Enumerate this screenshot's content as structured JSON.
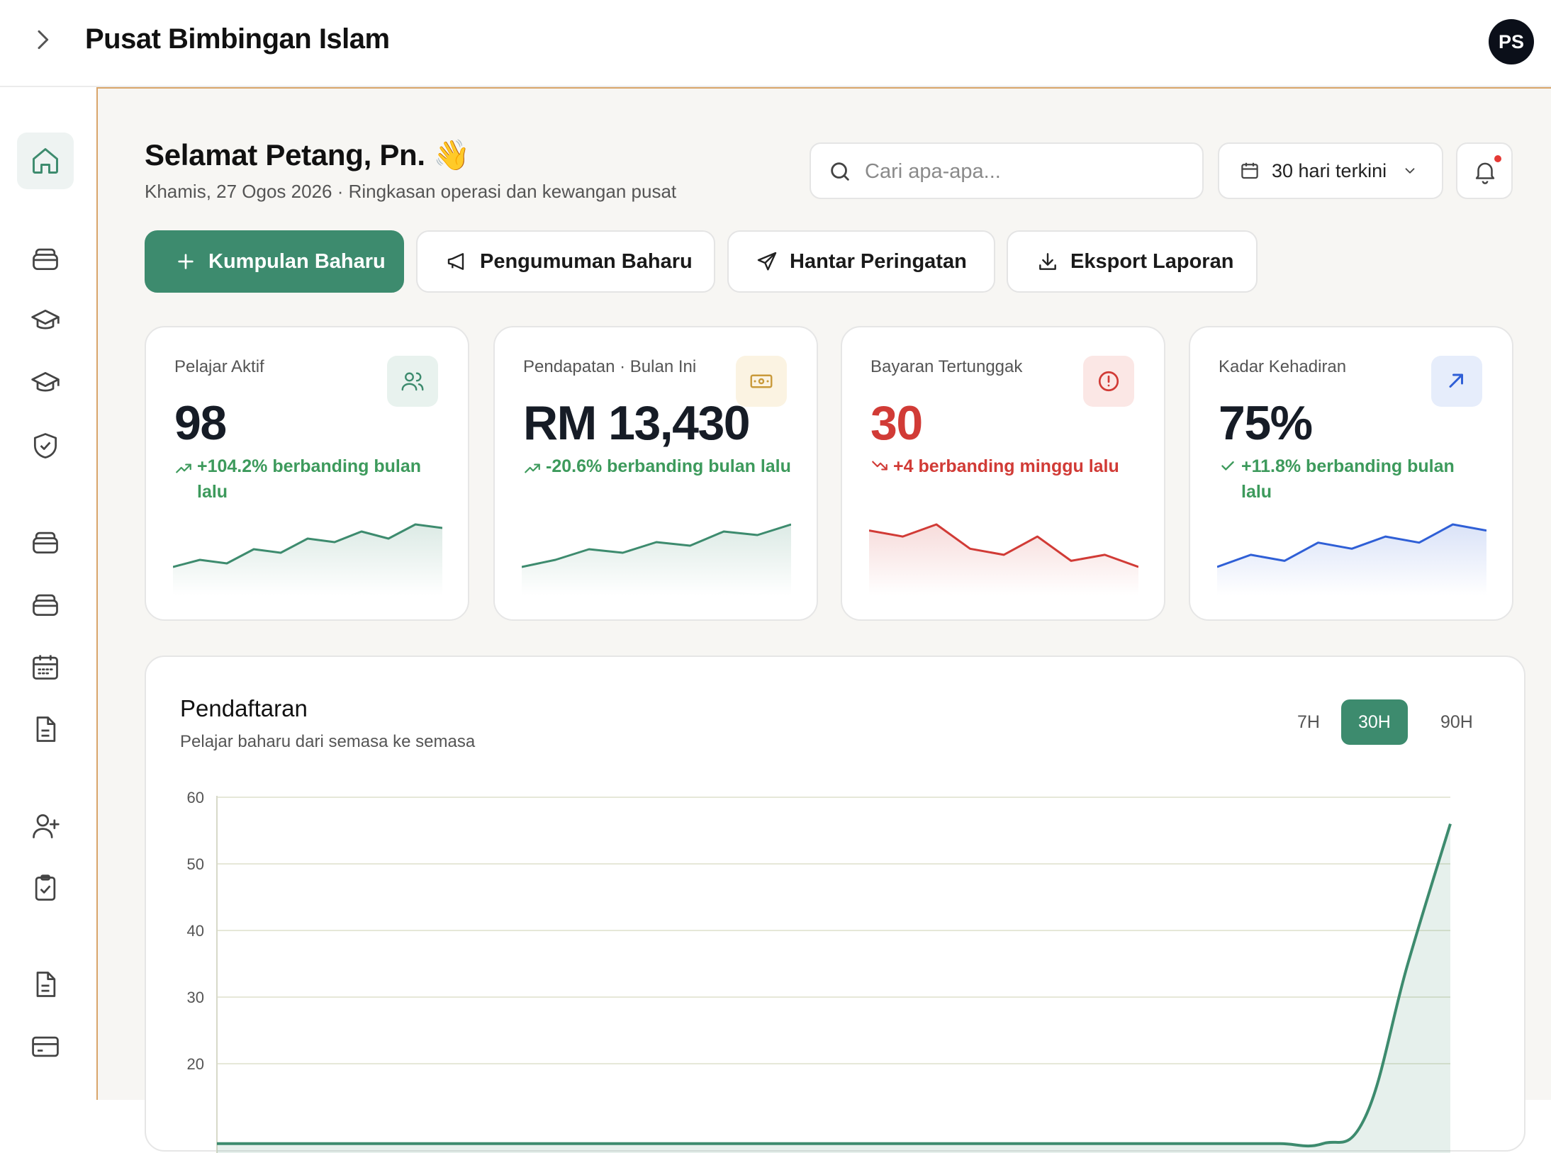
{
  "app": {
    "title": "Pusat Bimbingan Islam",
    "avatar_initials": "PS"
  },
  "header": {
    "greeting": "Selamat Petang, Pn. 👋",
    "subtitle": "Khamis, 27 Ogos 2026 · Ringkasan operasi dan kewangan pusat",
    "search_placeholder": "Cari apa-apa...",
    "date_range": "30 hari terkini"
  },
  "sidebar": {
    "items": [
      {
        "icon": "home-icon",
        "active": true
      },
      {
        "icon": "layers-icon"
      },
      {
        "icon": "graduation-cap-icon"
      },
      {
        "icon": "graduation-cap-icon"
      },
      {
        "icon": "shield-check-icon"
      },
      {
        "icon": "layers-icon"
      },
      {
        "icon": "layers-icon"
      },
      {
        "icon": "calendar-icon"
      },
      {
        "icon": "document-icon"
      },
      {
        "icon": "user-plus-icon"
      },
      {
        "icon": "clipboard-check-icon"
      },
      {
        "icon": "document-icon"
      },
      {
        "icon": "credit-card-icon"
      }
    ]
  },
  "actions": {
    "new_class": "Kumpulan Baharu",
    "new_announcement": "Pengumuman Baharu",
    "send_reminder": "Hantar Peringatan",
    "export_report": "Eksport Laporan"
  },
  "stats": [
    {
      "label": "Pelajar Aktif",
      "value": "98",
      "delta": "+104.2% berbanding bulan lalu",
      "trend": "up",
      "color": "#3d8b6e",
      "icon": "users-icon",
      "spark": [
        4,
        6,
        5,
        9,
        8,
        12,
        11,
        14,
        12,
        16,
        15
      ]
    },
    {
      "label": "Pendapatan · Bulan Ini",
      "value": "RM 13,430",
      "delta": "-20.6% berbanding bulan lalu",
      "trend": "up",
      "color": "#3d8b6e",
      "icon": "banknote-icon",
      "spark": [
        3,
        5,
        8,
        7,
        10,
        9,
        13,
        12,
        15
      ]
    },
    {
      "label": "Bayaran Tertunggak",
      "value": "30",
      "delta": "+4 berbanding minggu lalu",
      "trend": "down",
      "color": "#d13b36",
      "icon": "alert-circle-icon",
      "spark": [
        14,
        13,
        15,
        11,
        10,
        13,
        9,
        10,
        8
      ]
    },
    {
      "label": "Kadar Kehadiran",
      "value": "75%",
      "delta": "+11.8% berbanding bulan lalu",
      "trend": "check",
      "color": "#2f5fd6",
      "icon": "arrow-up-right-icon",
      "spark": [
        8,
        10,
        9,
        12,
        11,
        13,
        12,
        15,
        14
      ]
    }
  ],
  "chart_data": {
    "type": "area",
    "title": "Pendaftaran",
    "subtitle": "Pelajar baharu dari semasa ke semasa",
    "ranges": [
      "7H",
      "30H",
      "90H"
    ],
    "selected_range": "30H",
    "ylim": [
      20,
      60
    ],
    "yticks": [
      60,
      50,
      40,
      30,
      20
    ],
    "series": [
      {
        "values": [
          8,
          8,
          8,
          8,
          8,
          8,
          8,
          8,
          8,
          8,
          8,
          8,
          8,
          8,
          8,
          8,
          8,
          8,
          8,
          8,
          8,
          8,
          8,
          8,
          8,
          8,
          8,
          12,
          35,
          56
        ]
      }
    ],
    "grid": true,
    "color": "#3d8b6e"
  }
}
